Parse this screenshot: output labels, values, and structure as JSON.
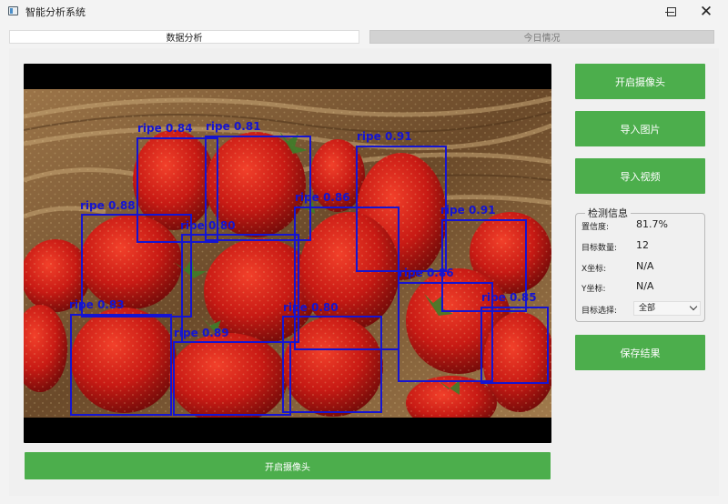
{
  "window": {
    "title": "智能分析系统"
  },
  "tabs": [
    {
      "label": "数据分析",
      "active": true
    },
    {
      "label": "今日情况",
      "active": false
    }
  ],
  "buttons": {
    "open_camera": "开启摄像头",
    "import_image": "导入图片",
    "import_video": "导入视频",
    "save_result": "保存结果",
    "bottom_open_camera": "开启摄像头"
  },
  "detection_info": {
    "title": "检测信息",
    "confidence_label": "置信度:",
    "confidence_value": "81.7%",
    "count_label": "目标数量:",
    "count_value": "12",
    "x_label": "X坐标:",
    "x_value": "N/A",
    "y_label": "Y坐标:",
    "y_value": "N/A",
    "target_select_label": "目标选择:",
    "target_select_value": "全部"
  },
  "detections": [
    {
      "label": "ripe 0.84"
    },
    {
      "label": "ripe 0.81"
    },
    {
      "label": "ripe 0.91"
    },
    {
      "label": "ripe 0.88"
    },
    {
      "label": "ripe 0.86"
    },
    {
      "label": "ripe 0.91"
    },
    {
      "label": "ripe 0.86"
    },
    {
      "label": "ripe 0.83"
    },
    {
      "label": "ripe 0.89"
    },
    {
      "label": "ripe 0.80"
    },
    {
      "label": "ripe 0.85"
    },
    {
      "label": "ripe 0.80"
    }
  ],
  "colors": {
    "accent_green": "#4cae4c",
    "box_blue": "#1414d2"
  }
}
